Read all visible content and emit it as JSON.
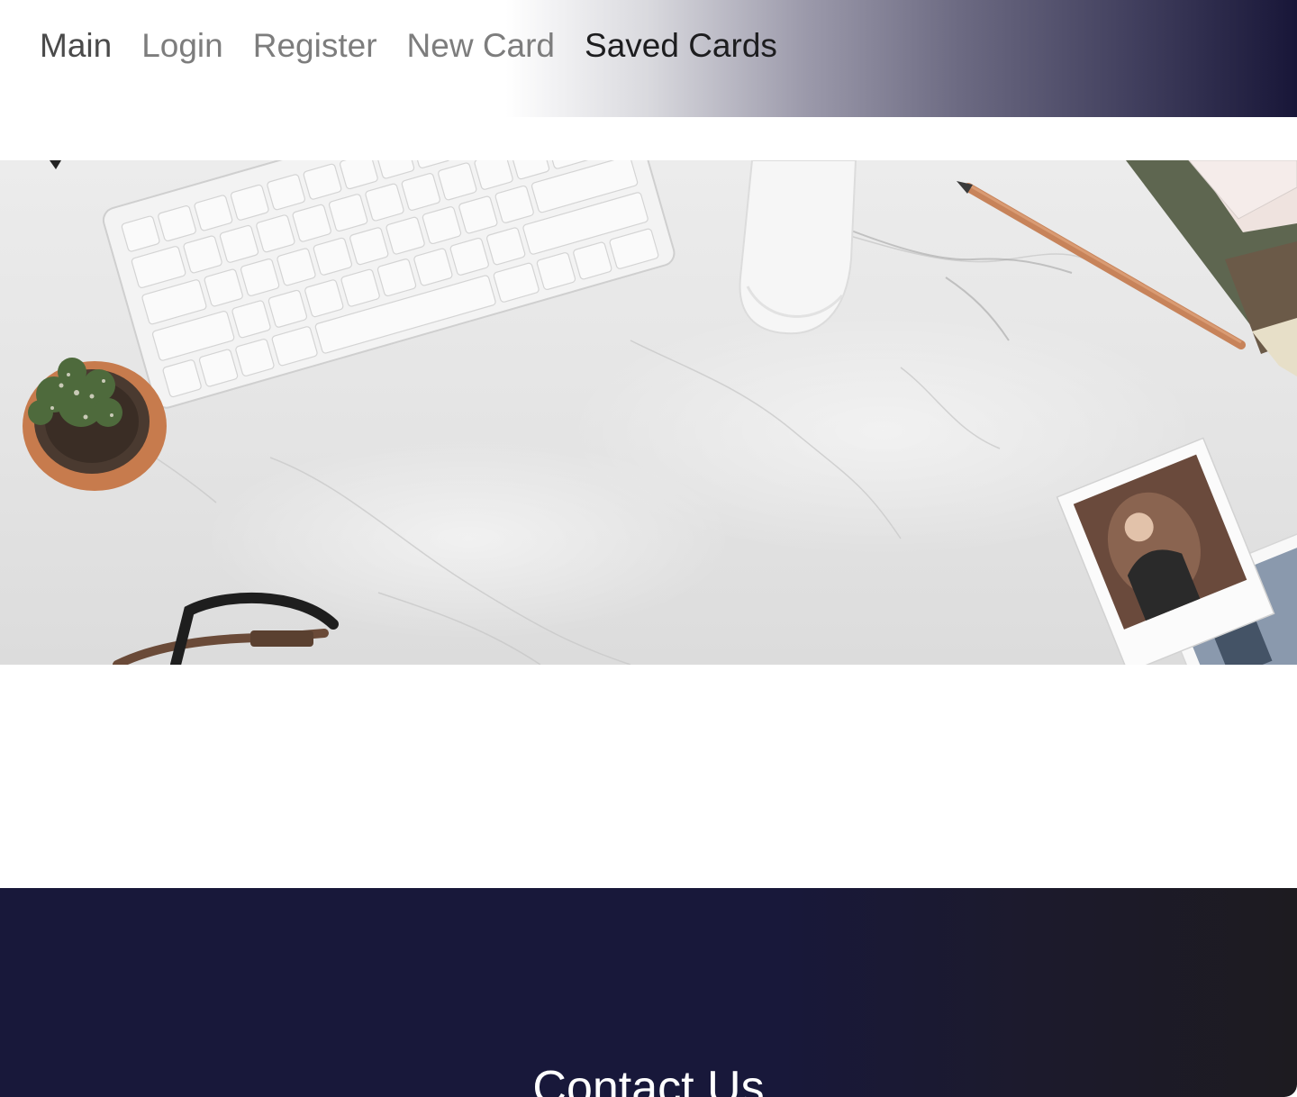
{
  "nav": {
    "items": [
      {
        "label": "Main",
        "name": "nav-link-main"
      },
      {
        "label": "Login",
        "name": "nav-link-login"
      },
      {
        "label": "Register",
        "name": "nav-link-register"
      },
      {
        "label": "New Card",
        "name": "nav-link-new-card"
      },
      {
        "label": "Saved Cards",
        "name": "nav-link-saved-cards"
      }
    ],
    "active": "Saved Cards"
  },
  "hero": {
    "image": "marble-desk-photo",
    "objects": [
      "keyboard",
      "mouse",
      "pencil",
      "cactus-pot",
      "notebooks",
      "polaroid-photos",
      "camera-strap"
    ]
  },
  "footer": {
    "title": "Contact Us"
  },
  "colors": {
    "nav_gradient_end": "#181638",
    "footer_bg": "#18183a",
    "footer_text": "#ffffff",
    "active_link": "#1d1d1f",
    "inactive_link": "#7d7d7d"
  }
}
